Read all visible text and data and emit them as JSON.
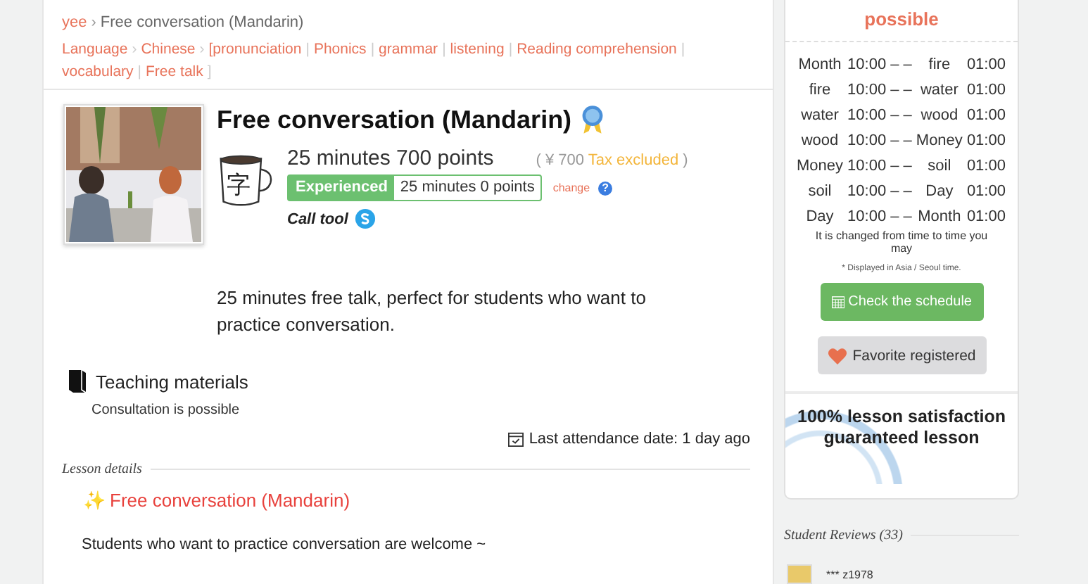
{
  "breadcrumb": [
    {
      "kind": "link",
      "label": "yee",
      "sep": "›"
    },
    {
      "kind": "current",
      "label": "Free conversation (Mandarin)"
    }
  ],
  "categories": [
    {
      "label": "Language",
      "sep": "›"
    },
    {
      "label": "Chinese",
      "sep": "›"
    },
    {
      "label": "[pronunciation",
      "sep": "|"
    },
    {
      "label": "Phonics",
      "sep": "|"
    },
    {
      "label": "grammar",
      "sep": "|"
    },
    {
      "label": "listening",
      "sep": "|"
    },
    {
      "label": "Reading comprehension",
      "sep": "|"
    },
    {
      "label": "vocabulary",
      "sep": "|"
    },
    {
      "label": "Free talk",
      "sep": "]"
    }
  ],
  "lesson": {
    "title": "Free conversation (Mandarin)",
    "price": "25 minutes 700 points",
    "yen": "( ¥ 700",
    "tax": "Tax excluded",
    "yen_close": ")",
    "change": "change",
    "help": "?",
    "trial_label": "Experienced",
    "trial_value": "25 minutes 0 points",
    "call_tool": "Call tool",
    "cup_char": "字"
  },
  "description": "25 minutes free talk, perfect for students who want to practice conversation.",
  "materials": {
    "title": "Teaching materials",
    "note": "Consultation is possible"
  },
  "last_attendance": "Last attendance date: 1 day ago",
  "details": {
    "heading": "Lesson details",
    "sparkle": "✨",
    "title": "Free conversation (Mandarin)",
    "body": "Students who want to practice conversation are welcome ~"
  },
  "schedule": {
    "heading": "possible",
    "rows": [
      {
        "from": "Month",
        "start": "10:00 – –",
        "to": "fire",
        "end": "01:00"
      },
      {
        "from": "fire",
        "start": "10:00 – –",
        "to": "water",
        "end": "01:00"
      },
      {
        "from": "water",
        "start": "10:00 – –",
        "to": "wood",
        "end": "01:00"
      },
      {
        "from": "wood",
        "start": "10:00 – –",
        "to": "Money",
        "end": "01:00"
      },
      {
        "from": "Money",
        "start": "10:00 – –",
        "to": "soil",
        "end": "01:00"
      },
      {
        "from": "soil",
        "start": "10:00 – –",
        "to": "Day",
        "end": "01:00"
      },
      {
        "from": "Day",
        "start": "10:00 – –",
        "to": "Month",
        "end": "01:00"
      }
    ],
    "note": "It is changed from time to time you may",
    "tz": "* Displayed in Asia / Seoul time.",
    "check_button": "Check the schedule",
    "favorite_button": "Favorite registered"
  },
  "guarantee": "100% lesson satisfaction guaranteed lesson",
  "reviews": {
    "heading": "Student Reviews (33)",
    "items": [
      {
        "name": "*** z1978"
      }
    ]
  }
}
